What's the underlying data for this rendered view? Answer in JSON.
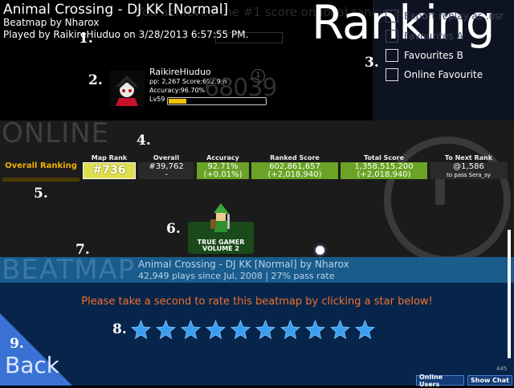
{
  "header": {
    "song_title": "Animal Crossing - DJ KK [Normal]",
    "beatmap_by": "Beatmap by Nharox",
    "played_by": "Played by RaikireHiuduo on 3/28/2013 6:57:55 PM.",
    "ranking_label": "Ranking"
  },
  "options": {
    "items": [
      {
        "label": "Export replay as .osr",
        "checked": false
      },
      {
        "label": "Favourites A",
        "checked": false
      },
      {
        "label": "Favourites B",
        "checked": false
      },
      {
        "label": "Online Favourite",
        "checked": false
      }
    ]
  },
  "player": {
    "name": "RaikireHiuduo",
    "stats": "pp: 2,267 Score:602.9m",
    "accuracy": "Accuracy:96.70%",
    "level": "Lv59",
    "level_progress": 0.18,
    "rank_number": "68039",
    "rank_marker": "1"
  },
  "online": {
    "section_label": "ONLINE",
    "overall_ranking_label": "Overall Ranking",
    "columns": {
      "map_rank": "Map Rank",
      "overall": "Overall",
      "accuracy": "Accuracy",
      "ranked_score": "Ranked Score",
      "total_score": "Total Score",
      "to_next_rank": "To Next Rank"
    },
    "values": {
      "map_rank": "#736",
      "overall": "#39,762",
      "overall_change": "-",
      "accuracy": "92.71%",
      "accuracy_change": "(+0.01%)",
      "ranked_score": "602,861,657",
      "ranked_score_change": "(+2,018,940)",
      "total_score": "1,358,515,200",
      "total_score_change": "(+2,018,940)",
      "to_next_rank": "@1,586",
      "to_next_rank_sub": "to pass Sera_sy"
    }
  },
  "badge": {
    "line1": "TRUE GAMER",
    "line2": "VOLUME 2"
  },
  "beatmap": {
    "section_label": "BEATMAP",
    "info_line1": "Animal Crossing - DJ KK [Normal] by Nharox",
    "info_line2": "42,949 plays since Jul, 2008 | 27% pass rate",
    "rate_message": "Please take a second to rate this beatmap by clicking a star below!",
    "star_count": 10
  },
  "footer": {
    "back_label": "Back",
    "online_users": "Online Users",
    "show_chat": "Show Chat",
    "version_text": "445"
  },
  "annotations": [
    "1.",
    "2.",
    "3.",
    "4.",
    "5.",
    "6.",
    "7.",
    "8.",
    "9."
  ],
  "colors": {
    "star": "#3a9ef0",
    "accent_green": "#6aa325",
    "map_rank_yellow": "#dede50",
    "beatmap_blue": "#1a5c8c",
    "rate_orange": "#f07030"
  }
}
